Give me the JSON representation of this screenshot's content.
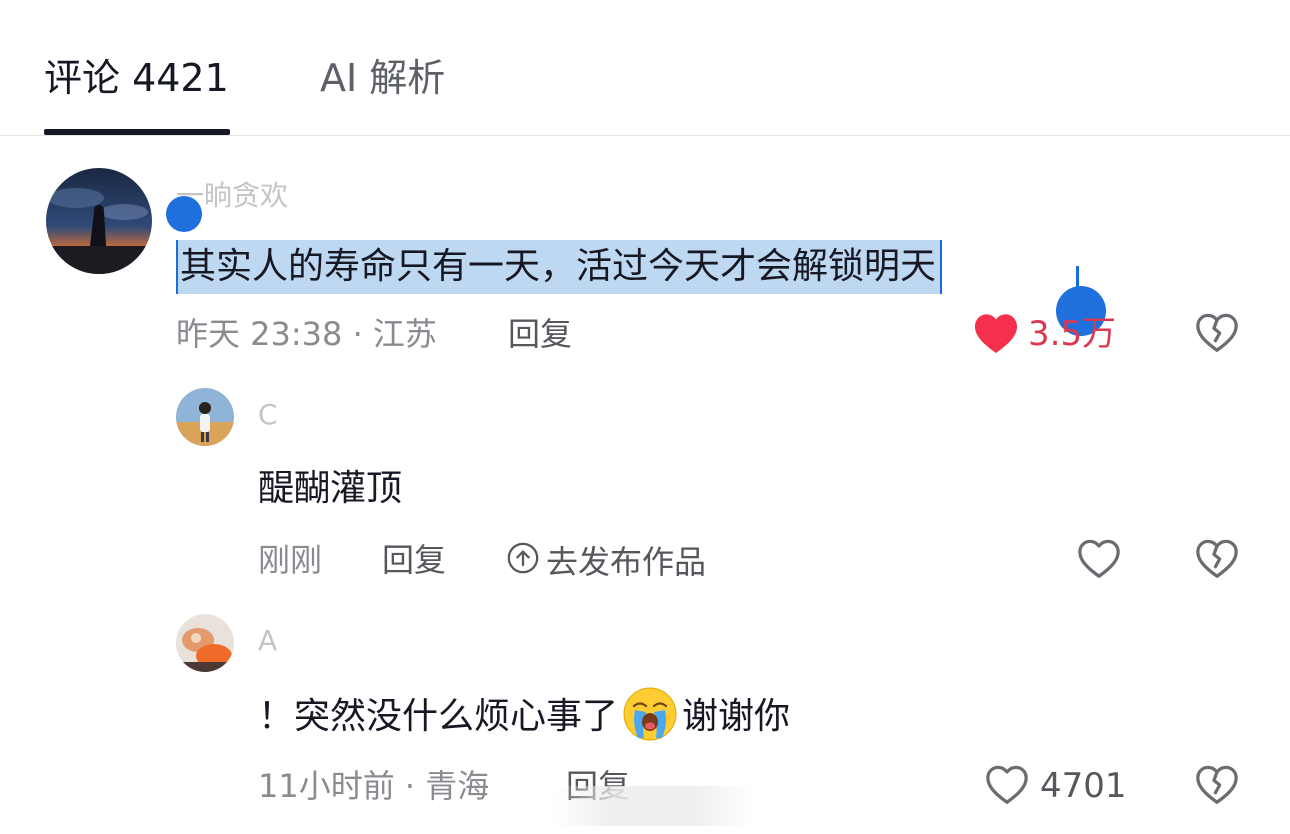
{
  "tabs": {
    "comments_label": "评论 4421",
    "ai_label": "AI 解析"
  },
  "comments": [
    {
      "username": "一晌贪欢",
      "text": "其实人的寿命只有一天，活过今天才会解锁明天",
      "meta": "昨天 23:38 · 江苏",
      "reply_label": "回复",
      "like_count": "3.5万",
      "liked": true,
      "selected": true
    },
    {
      "username": "C",
      "text": "醍醐灌顶",
      "meta": "刚刚",
      "reply_label": "回复",
      "post_work_label": "去发布作品",
      "like_count": "",
      "liked": false
    },
    {
      "username": "A",
      "text_before_emoji": "！突然没什么烦心事了",
      "emoji": "loudly-crying-face",
      "text_after_emoji": "谢谢你",
      "meta": "11小时前 · 青海",
      "reply_label": "回复",
      "like_count": "4701",
      "liked": false
    }
  ],
  "colors": {
    "text_primary": "#161823",
    "text_secondary": "#8a8b91",
    "like_active": "#fe2c55",
    "selection_bg": "#bfd8f2",
    "selection_handle": "#1f6fdc"
  }
}
